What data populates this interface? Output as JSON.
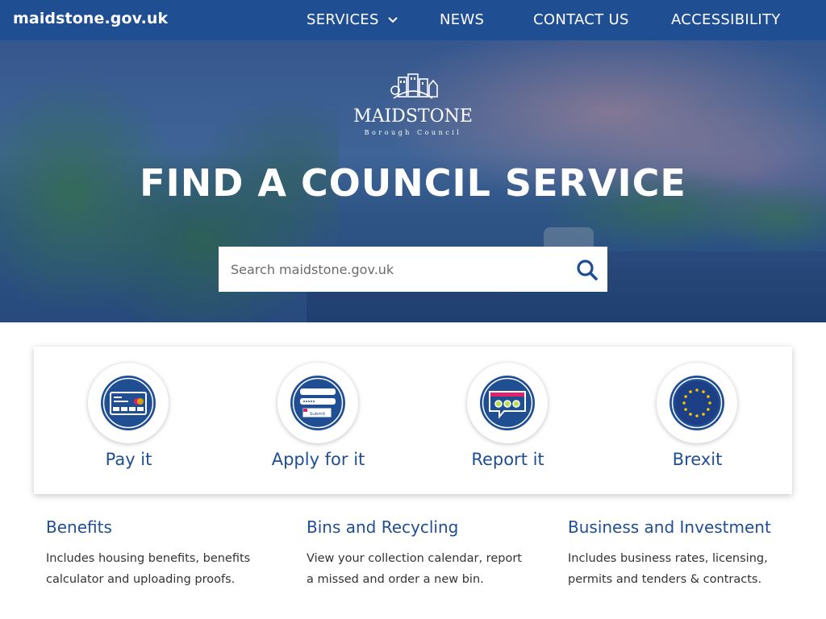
{
  "header": {
    "site_name": "maidstone.gov.uk",
    "nav": [
      {
        "label": "SERVICES"
      },
      {
        "label": "NEWS"
      },
      {
        "label": "CONTACT US"
      },
      {
        "label": "ACCESSIBILITY"
      }
    ]
  },
  "hero": {
    "logo_word": "MAIDSTONE",
    "logo_sub": "Borough Council",
    "title": "FIND A COUNCIL SERVICE",
    "search_placeholder": "Search maidstone.gov.uk",
    "search_icon": "search-icon"
  },
  "actions": [
    {
      "label": "Pay it",
      "icon": "payment-card-icon"
    },
    {
      "label": "Apply for it",
      "icon": "form-submit-icon",
      "icon_text": "Submit"
    },
    {
      "label": "Report it",
      "icon": "speech-bubble-icon"
    },
    {
      "label": "Brexit",
      "icon": "eu-flag-icon"
    }
  ],
  "categories": [
    {
      "title": "Benefits",
      "description": "Includes housing benefits, benefits calculator and uploading proofs."
    },
    {
      "title": "Bins and Recycling",
      "description": "View your collection calendar, report a missed and order a new bin."
    },
    {
      "title": "Business and Investment",
      "description": "Includes business rates, licensing, permits and tenders & contracts."
    }
  ],
  "colors": {
    "brand_blue": "#1f4e93",
    "accent_pink": "#e0226a",
    "card_gray": "#333333"
  }
}
